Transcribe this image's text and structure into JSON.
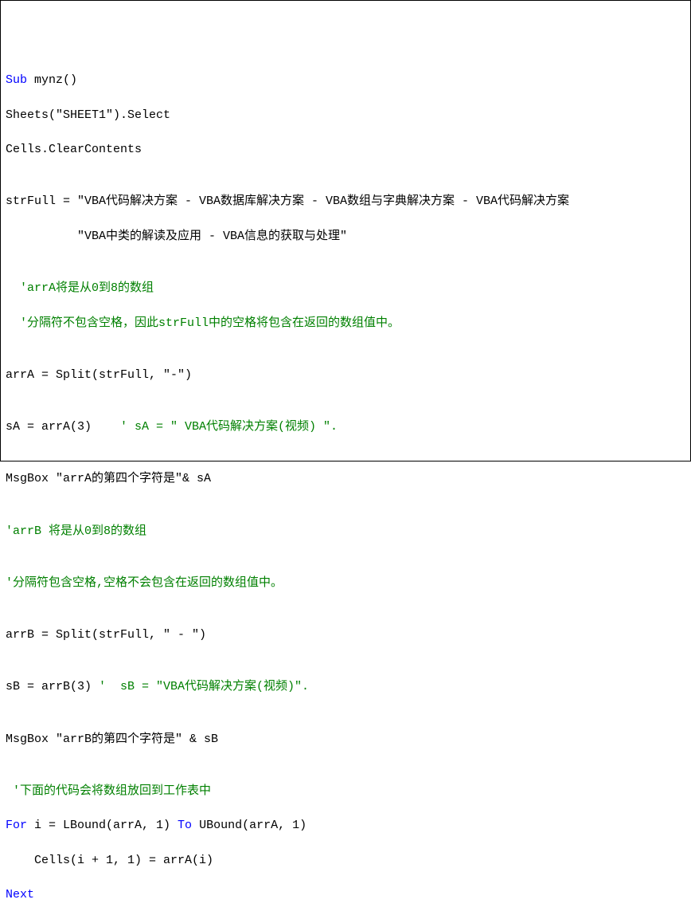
{
  "code": {
    "line1_kw": "Sub ",
    "line1_name": "mynz()",
    "line2": "Sheets(\"SHEET1\").Select",
    "line3": "Cells.ClearContents",
    "line4": "",
    "line5": "strFull = \"VBA代码解决方案 - VBA数据库解决方案 - VBA数组与字典解决方案 - VBA代码解决方案",
    "line6": "          \"VBA中类的解读及应用 - VBA信息的获取与处理\"",
    "line7": "",
    "line8_c": "  'arrA将是从0到8的数组",
    "line9_c": "  '分隔符不包含空格，因此strFull中的空格将包含在返回的数组值中。",
    "line10": "",
    "line11": "arrA = Split(strFull, \"-\")",
    "line12": "",
    "line13a": "sA = arrA(3)   ",
    "line13b": " ' sA = \" VBA代码解决方案(视频) \".",
    "line14": "",
    "line15": "MsgBox \"arrA的第四个字符是\"& sA",
    "line16": "",
    "line17_c": "'arrB 将是从0到8的数组",
    "line18": "",
    "line19_c": "'分隔符包含空格,空格不会包含在返回的数组值中。",
    "line20": "",
    "line21": "arrB = Split(strFull, \" - \")",
    "line22": "",
    "line23a": "sB = arrB(3) ",
    "line23b": "'  sB = \"VBA代码解决方案(视频)\".",
    "line24": "",
    "line25": "MsgBox \"arrB的第四个字符是\" & sB",
    "line26": "",
    "line27_c": " '下面的代码会将数组放回到工作表中",
    "line28_kw1": "For ",
    "line28_mid": "i = LBound(arrA, 1) ",
    "line28_kw2": "To ",
    "line28_end": "UBound(arrA, 1)",
    "line29": "    Cells(i + 1, 1) = arrA(i)",
    "line30_kw": "Next"
  }
}
